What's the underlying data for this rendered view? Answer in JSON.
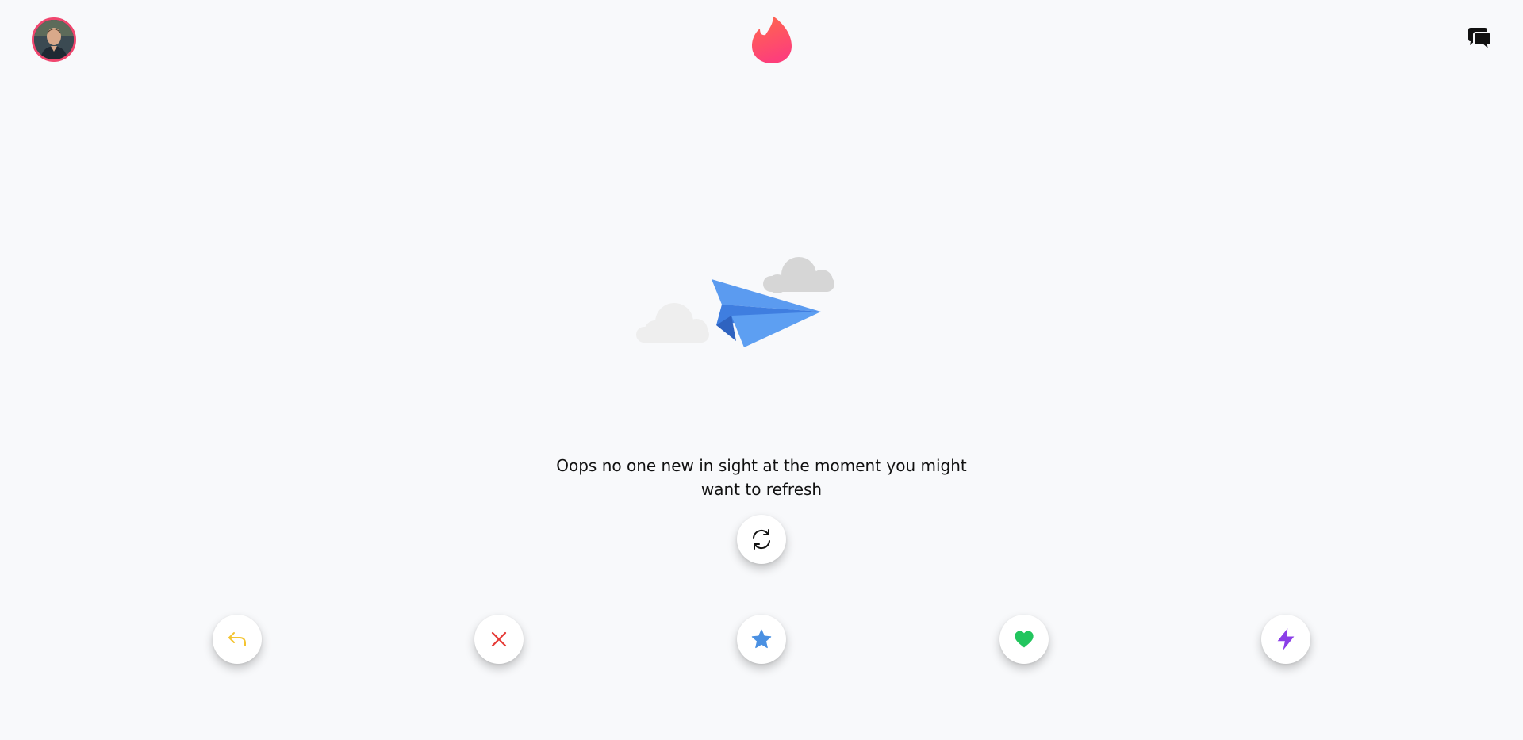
{
  "header": {
    "profile_avatar_icon": "user-avatar",
    "logo_icon": "flame-icon",
    "chat_icon": "chat-bubbles-icon"
  },
  "empty_state": {
    "illustration": "paper-plane-icon",
    "message": "Oops no one new in sight at the moment you might want to refresh",
    "refresh_icon": "refresh-icon"
  },
  "actions": [
    {
      "name": "rewind",
      "icon": "undo-arrow-icon",
      "color": "#f4c430"
    },
    {
      "name": "nope",
      "icon": "close-icon",
      "color": "#e53935"
    },
    {
      "name": "super-like",
      "icon": "star-icon",
      "color": "#4a90e2"
    },
    {
      "name": "like",
      "icon": "heart-icon",
      "color": "#22c55e"
    },
    {
      "name": "boost",
      "icon": "lightning-icon",
      "color": "#8b3fe8"
    }
  ],
  "colors": {
    "brand": "#fd5068",
    "background": "#f8f9fb"
  }
}
